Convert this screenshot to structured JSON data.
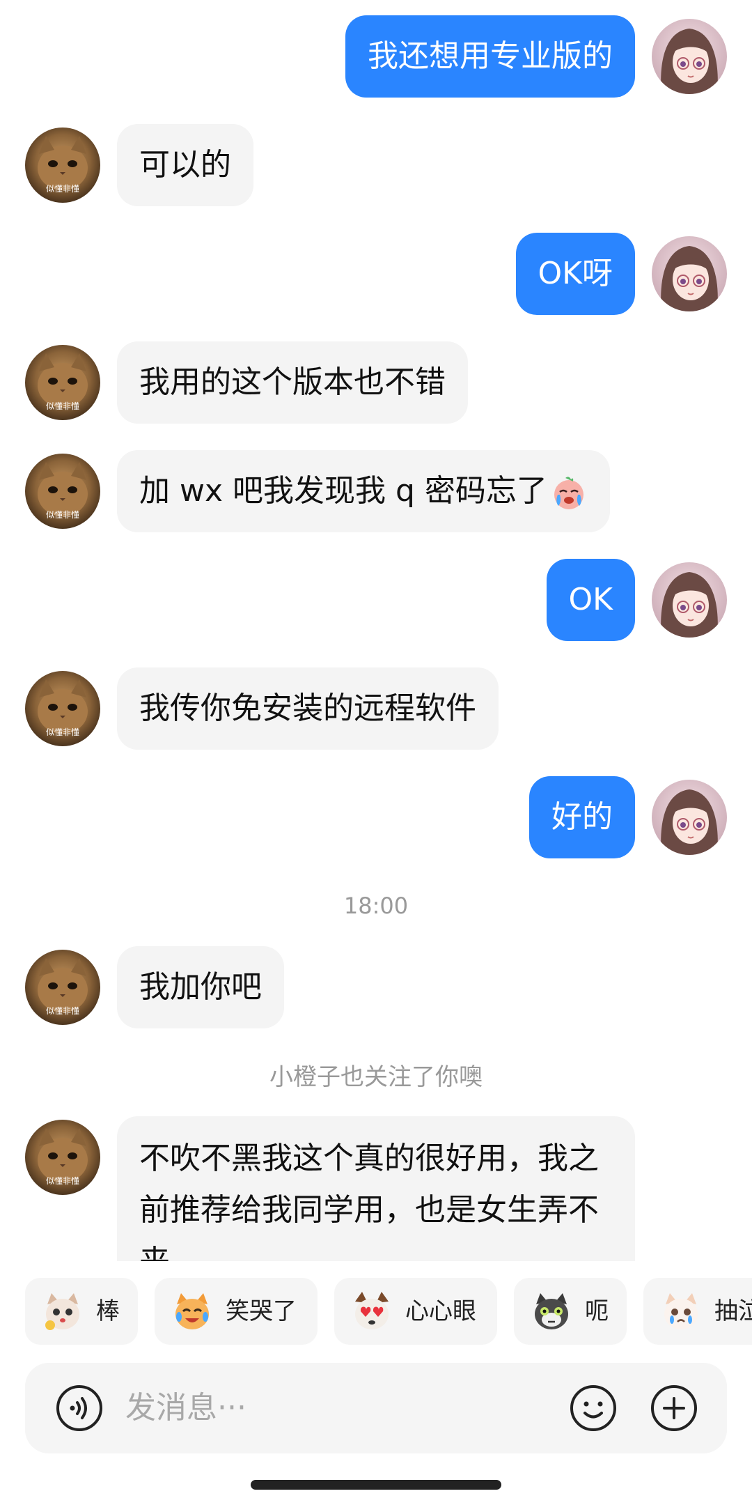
{
  "chat": {
    "messages": {
      "m1": {
        "side": "right",
        "text": "我还想用专业版的"
      },
      "m2": {
        "side": "left",
        "text": "可以的"
      },
      "m3": {
        "side": "right",
        "text": "OK呀"
      },
      "m4": {
        "side": "left",
        "text": "我用的这个版本也不错"
      },
      "m5": {
        "side": "left",
        "text": "加 wx 吧我发现我 q 密码忘了",
        "emoji": "crying-face-emoji"
      },
      "m6": {
        "side": "right",
        "text": "OK"
      },
      "m7": {
        "side": "left",
        "text": "我传你免安装的远程软件"
      },
      "m8": {
        "side": "right",
        "text": "好的"
      },
      "m9": {
        "side": "left",
        "text": "我加你吧"
      },
      "m10": {
        "side": "left",
        "text": "不吹不黑我这个真的很好用，我之前推荐给我同学用，也是女生弄不来"
      }
    },
    "timestamp": "18:00",
    "system_notice": "小橙子也关注了你噢",
    "avatars": {
      "left": {
        "icon": "cat-avatar",
        "caption": "似懂非懂"
      },
      "right": {
        "icon": "anime-girl-avatar"
      }
    }
  },
  "stickers": [
    {
      "label": "棒",
      "icon": "cat-thumbs-up-sticker-icon"
    },
    {
      "label": "笑哭了",
      "icon": "laughing-tears-cat-sticker-icon"
    },
    {
      "label": "心心眼",
      "icon": "heart-eyes-dog-sticker-icon"
    },
    {
      "label": "呃",
      "icon": "awkward-cat-sticker-icon"
    },
    {
      "label": "抽泣",
      "icon": "sobbing-cat-sticker-icon"
    }
  ],
  "input": {
    "placeholder": "发消息···",
    "voice_icon": "voice-icon",
    "emoji_icon": "emoji-icon",
    "plus_icon": "plus-icon"
  },
  "colors": {
    "outgoing_bubble": "#2a85ff",
    "incoming_bubble": "#f4f4f4",
    "meta_text": "#999999"
  }
}
